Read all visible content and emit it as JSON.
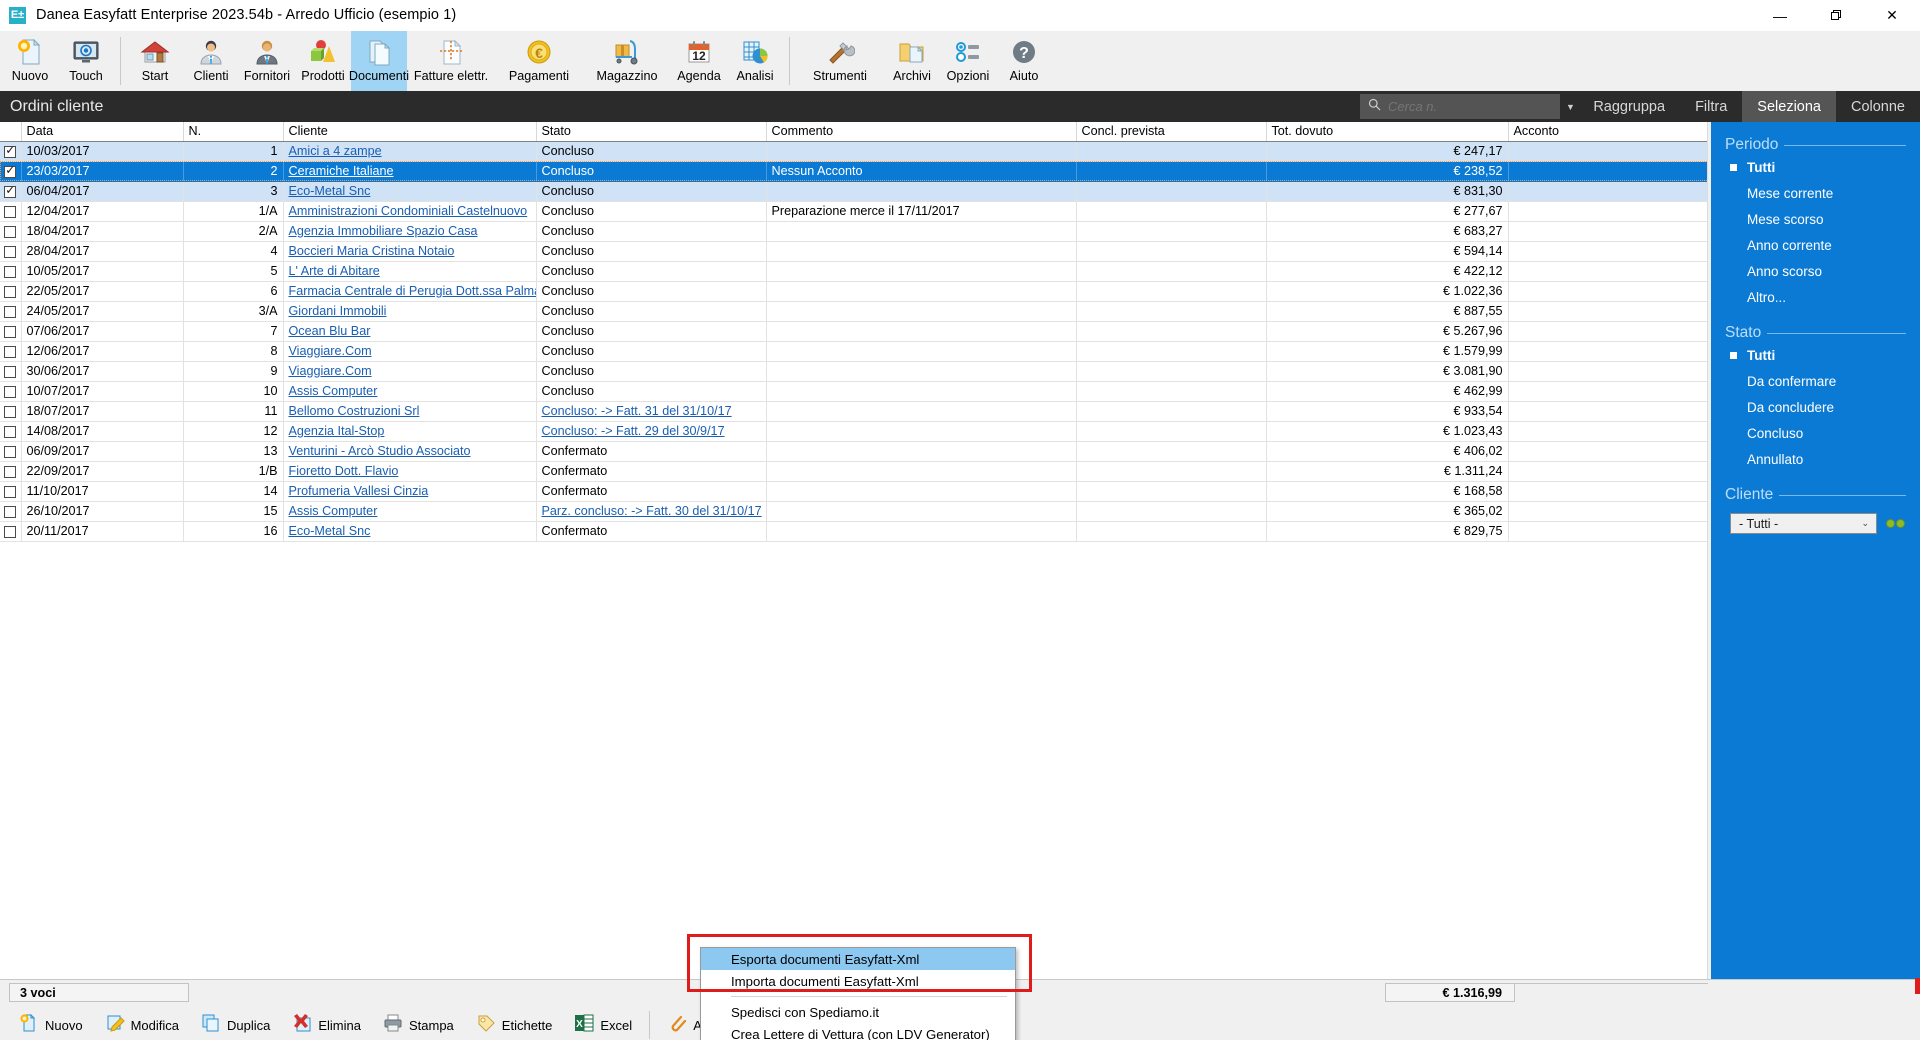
{
  "window": {
    "logo_text": "E±",
    "title": "Danea Easyfatt Enterprise  2023.54b  -  Arredo Ufficio (esempio 1)",
    "minimize": "—",
    "maximize": "❐",
    "close": "✕"
  },
  "ribbon": {
    "groups": [
      {
        "items": [
          {
            "label": "Nuovo",
            "icon": "new-document-icon",
            "active": false
          },
          {
            "label": "Touch",
            "icon": "touch-screen-icon",
            "active": false
          }
        ]
      },
      {
        "items": [
          {
            "label": "Start",
            "icon": "home-icon",
            "active": false
          },
          {
            "label": "Clienti",
            "icon": "customer-icon",
            "active": false
          },
          {
            "label": "Fornitori",
            "icon": "supplier-icon",
            "active": false
          },
          {
            "label": "Prodotti",
            "icon": "products-icon",
            "active": false
          },
          {
            "label": "Documenti",
            "icon": "documents-icon",
            "active": true
          },
          {
            "label": "Fatture elettr.",
            "icon": "e-invoice-icon",
            "active": false
          },
          {
            "label": "Pagamenti",
            "icon": "euro-coin-icon",
            "active": false
          },
          {
            "label": "Magazzino",
            "icon": "warehouse-icon",
            "active": false
          },
          {
            "label": "Agenda",
            "icon": "calendar-icon",
            "active": false
          },
          {
            "label": "Analisi",
            "icon": "chart-icon",
            "active": false
          }
        ]
      },
      {
        "items": [
          {
            "label": "Strumenti",
            "icon": "tools-icon",
            "active": false
          },
          {
            "label": "Archivi",
            "icon": "archive-folder-icon",
            "active": false
          },
          {
            "label": "Opzioni",
            "icon": "options-icon",
            "active": false
          },
          {
            "label": "Aiuto",
            "icon": "help-icon",
            "active": false
          }
        ]
      }
    ]
  },
  "header": {
    "title": "Ordini cliente",
    "search_placeholder": "Cerca n.",
    "search_value": "",
    "search_icon": "search-icon",
    "dropdown_icon": "chevron-down-icon",
    "buttons": [
      {
        "label": "Raggruppa",
        "active": false
      },
      {
        "label": "Filtra",
        "active": false
      },
      {
        "label": "Seleziona",
        "active": true
      },
      {
        "label": "Colonne",
        "active": false
      }
    ]
  },
  "grid": {
    "columns": [
      "",
      "Data",
      "N.",
      "Cliente",
      "Stato",
      "Commento",
      "Concl. prevista",
      "Tot. dovuto",
      "Acconto"
    ],
    "rows": [
      {
        "checked": true,
        "state": "light",
        "data": "10/03/2017",
        "n": "1",
        "cliente": "Amici a 4 zampe",
        "stato": "Concluso",
        "stato_link": false,
        "commento": "",
        "concl": "",
        "tot": "€ 247,17",
        "acconto": ""
      },
      {
        "checked": true,
        "state": "sel",
        "data": "23/03/2017",
        "n": "2",
        "cliente": "Ceramiche Italiane",
        "stato": "Concluso",
        "stato_link": false,
        "commento": "Nessun Acconto",
        "concl": "",
        "tot": "€ 238,52",
        "acconto": ""
      },
      {
        "checked": true,
        "state": "light",
        "data": "06/04/2017",
        "n": "3",
        "cliente": "Eco-Metal Snc",
        "stato": "Concluso",
        "stato_link": false,
        "commento": "",
        "concl": "",
        "tot": "€ 831,30",
        "acconto": ""
      },
      {
        "checked": false,
        "state": "white",
        "data": "12/04/2017",
        "n": "1/A",
        "cliente": "Amministrazioni Condominiali Castelnuovo",
        "stato": "Concluso",
        "stato_link": false,
        "commento": "Preparazione merce il 17/11/2017",
        "concl": "",
        "tot": "€ 277,67",
        "acconto": ""
      },
      {
        "checked": false,
        "state": "white",
        "data": "18/04/2017",
        "n": "2/A",
        "cliente": "Agenzia Immobiliare Spazio Casa",
        "stato": "Concluso",
        "stato_link": false,
        "commento": "",
        "concl": "",
        "tot": "€ 683,27",
        "acconto": ""
      },
      {
        "checked": false,
        "state": "white",
        "data": "28/04/2017",
        "n": "4",
        "cliente": "Boccieri Maria Cristina Notaio",
        "stato": "Concluso",
        "stato_link": false,
        "commento": "",
        "concl": "",
        "tot": "€ 594,14",
        "acconto": ""
      },
      {
        "checked": false,
        "state": "white",
        "data": "10/05/2017",
        "n": "5",
        "cliente": "L' Arte di Abitare",
        "stato": "Concluso",
        "stato_link": false,
        "commento": "",
        "concl": "",
        "tot": "€ 422,12",
        "acconto": ""
      },
      {
        "checked": false,
        "state": "white",
        "data": "22/05/2017",
        "n": "6",
        "cliente": "Farmacia Centrale di Perugia Dott.ssa Palma M",
        "stato": "Concluso",
        "stato_link": false,
        "commento": "",
        "concl": "",
        "tot": "€ 1.022,36",
        "acconto": ""
      },
      {
        "checked": false,
        "state": "white",
        "data": "24/05/2017",
        "n": "3/A",
        "cliente": "Giordani Immobili",
        "stato": "Concluso",
        "stato_link": false,
        "commento": "",
        "concl": "",
        "tot": "€ 887,55",
        "acconto": ""
      },
      {
        "checked": false,
        "state": "white",
        "data": "07/06/2017",
        "n": "7",
        "cliente": "Ocean Blu Bar",
        "stato": "Concluso",
        "stato_link": false,
        "commento": "",
        "concl": "",
        "tot": "€ 5.267,96",
        "acconto": ""
      },
      {
        "checked": false,
        "state": "white",
        "data": "12/06/2017",
        "n": "8",
        "cliente": "Viaggiare.Com",
        "stato": "Concluso",
        "stato_link": false,
        "commento": "",
        "concl": "",
        "tot": "€ 1.579,99",
        "acconto": ""
      },
      {
        "checked": false,
        "state": "white",
        "data": "30/06/2017",
        "n": "9",
        "cliente": "Viaggiare.Com",
        "stato": "Concluso",
        "stato_link": false,
        "commento": "",
        "concl": "",
        "tot": "€ 3.081,90",
        "acconto": ""
      },
      {
        "checked": false,
        "state": "white",
        "data": "10/07/2017",
        "n": "10",
        "cliente": "Assis Computer",
        "stato": "Concluso",
        "stato_link": false,
        "commento": "",
        "concl": "",
        "tot": "€ 462,99",
        "acconto": ""
      },
      {
        "checked": false,
        "state": "white",
        "data": "18/07/2017",
        "n": "11",
        "cliente": "Bellomo Costruzioni Srl",
        "stato": "Concluso:   -> Fatt. 31 del 31/10/17",
        "stato_link": true,
        "commento": "",
        "concl": "",
        "tot": "€ 933,54",
        "acconto": ""
      },
      {
        "checked": false,
        "state": "white",
        "data": "14/08/2017",
        "n": "12",
        "cliente": "Agenzia Ital-Stop",
        "stato": "Concluso:   -> Fatt. 29 del 30/9/17",
        "stato_link": true,
        "commento": "",
        "concl": "",
        "tot": "€ 1.023,43",
        "acconto": ""
      },
      {
        "checked": false,
        "state": "white",
        "data": "06/09/2017",
        "n": "13",
        "cliente": "Venturini - Arcò Studio Associato",
        "stato": "Confermato",
        "stato_link": false,
        "commento": "",
        "concl": "",
        "tot": "€ 406,02",
        "acconto": ""
      },
      {
        "checked": false,
        "state": "white",
        "data": "22/09/2017",
        "n": "1/B",
        "cliente": "Fioretto Dott. Flavio",
        "stato": "Confermato",
        "stato_link": false,
        "commento": "",
        "concl": "",
        "tot": "€ 1.311,24",
        "acconto": ""
      },
      {
        "checked": false,
        "state": "white",
        "data": "11/10/2017",
        "n": "14",
        "cliente": "Profumeria Vallesi Cinzia",
        "stato": "Confermato",
        "stato_link": false,
        "commento": "",
        "concl": "",
        "tot": "€ 168,58",
        "acconto": ""
      },
      {
        "checked": false,
        "state": "white",
        "data": "26/10/2017",
        "n": "15",
        "cliente": "Assis Computer",
        "stato": "Parz. concluso:   -> Fatt. 30 del 31/10/17",
        "stato_link": true,
        "commento": "",
        "concl": "",
        "tot": "€ 365,02",
        "acconto": ""
      },
      {
        "checked": false,
        "state": "white",
        "data": "20/11/2017",
        "n": "16",
        "cliente": "Eco-Metal Snc",
        "stato": "Confermato",
        "stato_link": false,
        "commento": "",
        "concl": "",
        "tot": "€ 829,75",
        "acconto": ""
      }
    ]
  },
  "sidebar": {
    "groups": [
      {
        "title": "Periodo",
        "options": [
          {
            "label": "Tutti",
            "selected": true
          },
          {
            "label": "Mese corrente",
            "selected": false
          },
          {
            "label": "Mese scorso",
            "selected": false
          },
          {
            "label": "Anno corrente",
            "selected": false
          },
          {
            "label": "Anno scorso",
            "selected": false
          },
          {
            "label": "Altro...",
            "selected": false
          }
        ]
      },
      {
        "title": "Stato",
        "options": [
          {
            "label": "Tutti",
            "selected": true
          },
          {
            "label": "Da confermare",
            "selected": false
          },
          {
            "label": "Da concludere",
            "selected": false
          },
          {
            "label": "Concluso",
            "selected": false
          },
          {
            "label": "Annullato",
            "selected": false
          }
        ]
      }
    ],
    "cliente": {
      "title": "Cliente",
      "combo_value": "- Tutti -",
      "combo_caret": "⌄",
      "binocular_icon": "binoculars-icon"
    }
  },
  "statusbar": {
    "count_label": "3 voci",
    "total_label": "€ 1.316,99"
  },
  "bottombar": {
    "items": [
      {
        "label": "Nuovo",
        "icon": "new-document-icon"
      },
      {
        "label": "Modifica",
        "icon": "edit-pencil-icon"
      },
      {
        "label": "Duplica",
        "icon": "duplicate-icon"
      },
      {
        "label": "Elimina",
        "icon": "delete-x-icon"
      },
      {
        "label": "Stampa",
        "icon": "printer-icon"
      },
      {
        "label": "Etichette",
        "icon": "label-tag-icon"
      },
      {
        "label": "Excel",
        "icon": "excel-icon"
      },
      {
        "label": "Allegati...",
        "icon": "paperclip-icon"
      }
    ]
  },
  "context_menu": {
    "items": [
      {
        "label": "Esporta documenti Easyfatt-Xml",
        "highlighted": true,
        "divider_after": false
      },
      {
        "label": "Importa documenti Easyfatt-Xml",
        "highlighted": false,
        "divider_after": true
      },
      {
        "label": "Spedisci con Spediamo.it",
        "highlighted": false,
        "divider_after": false
      },
      {
        "label": "Crea Lettere di Vettura (con LDV Generator)",
        "highlighted": false,
        "divider_after": false
      }
    ],
    "highlight_color": "#e01b1b"
  }
}
